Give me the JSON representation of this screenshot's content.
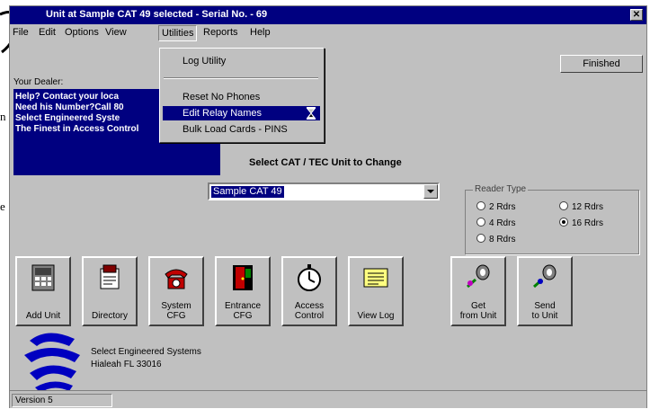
{
  "window": {
    "title": "Unit at Sample CAT 49 selected  - Serial No. - 69",
    "close_glyph": "✕"
  },
  "menu": [
    {
      "label": "File"
    },
    {
      "label": "Edit"
    },
    {
      "label": "Options"
    },
    {
      "label": "View"
    },
    {
      "label": "Utilities"
    },
    {
      "label": "Reports"
    },
    {
      "label": "Help"
    }
  ],
  "utilities_menu": {
    "items": [
      "Log Utility",
      "Reset No Phones",
      "Edit Relay Names",
      "Bulk Load Cards - PINS"
    ],
    "selected_index": 2
  },
  "finished_button": "Finished",
  "dealer": {
    "label": "Your Dealer:",
    "lines": [
      "Help? Contact  your loca",
      "Need his Number?Call 80",
      "  Select Engineered Syste",
      "     The Finest in Access Control"
    ]
  },
  "unit_select": {
    "label": "Select CAT / TEC Unit to Change",
    "value": "Sample CAT 49"
  },
  "reader_type": {
    "title": "Reader Type",
    "options": [
      "2 Rdrs",
      "4 Rdrs",
      "8 Rdrs",
      "12 Rdrs",
      "16 Rdrs"
    ],
    "selected": "16 Rdrs"
  },
  "toolbar": {
    "add_unit": "Add Unit",
    "directory": "Directory",
    "system_cfg": "System\nCFG",
    "entrance_cfg": "Entrance\nCFG",
    "access_control": "Access\nControl",
    "view_log": "View Log",
    "get_from_unit": "Get\nfrom Unit",
    "send_to_unit": "Send\nto Unit"
  },
  "company": {
    "name": "Select Engineered Systems",
    "address": "Hialeah FL 33016"
  },
  "status": {
    "version": "Version 5"
  },
  "colors": {
    "title_bar": "#000080",
    "face": "#c0c0c0",
    "selection": "#000080"
  }
}
